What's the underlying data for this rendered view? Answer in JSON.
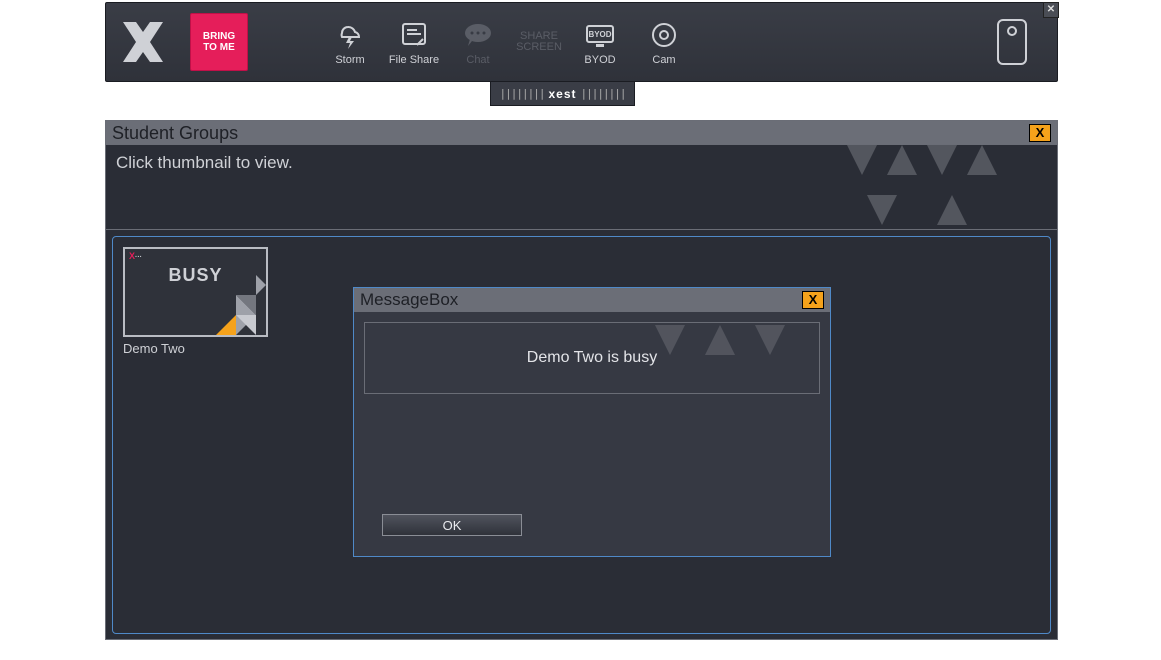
{
  "toolbar": {
    "bring_label": "BRING\nTO ME",
    "items": [
      {
        "id": "storm",
        "label": "Storm"
      },
      {
        "id": "fileshare",
        "label": "File Share"
      },
      {
        "id": "chat",
        "label": "Chat",
        "disabled": true
      },
      {
        "id": "sharescreen",
        "label_line1": "SHARE",
        "label_line2": "SCREEN",
        "disabled": true
      },
      {
        "id": "byod",
        "label": "BYOD"
      },
      {
        "id": "cam",
        "label": "Cam"
      }
    ],
    "close_glyph": "✕",
    "hang_tab_brand": "xest"
  },
  "panel": {
    "title": "Student Groups",
    "close_glyph": "X",
    "hint": "Click thumbnail to view."
  },
  "thumbnail": {
    "status_text": "BUSY",
    "label": "Demo Two",
    "mini_brand": "X"
  },
  "messagebox": {
    "title": "MessageBox",
    "close_glyph": "X",
    "body": "Demo Two is busy",
    "ok_label": "OK"
  },
  "colors": {
    "accent_pink": "#e51e5a",
    "accent_orange": "#f5a21b",
    "accent_blue": "#4f89c8"
  }
}
